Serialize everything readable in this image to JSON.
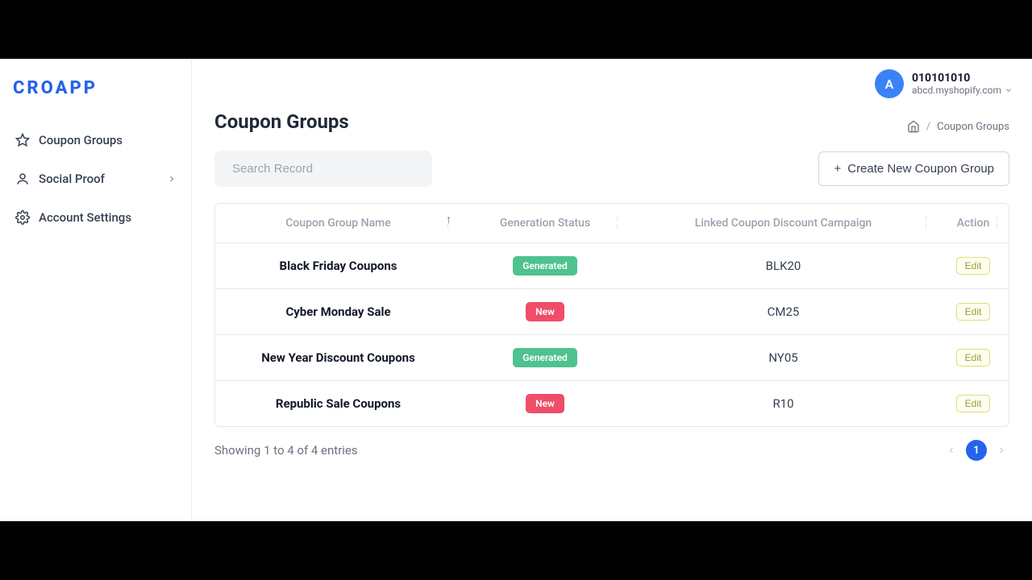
{
  "brand": "CROAPP",
  "user": {
    "avatar_letter": "A",
    "name": "010101010",
    "store": "abcd.myshopify.com"
  },
  "sidebar": {
    "items": [
      {
        "label": "Coupon Groups"
      },
      {
        "label": "Social Proof"
      },
      {
        "label": "Account Settings"
      }
    ]
  },
  "page": {
    "title": "Coupon Groups",
    "breadcrumb_current": "Coupon Groups",
    "breadcrumb_sep": "/"
  },
  "search": {
    "placeholder": "Search Record"
  },
  "buttons": {
    "create": "Create New Coupon Group",
    "edit": "Edit"
  },
  "table": {
    "headers": {
      "name": "Coupon Group Name",
      "status": "Generation Status",
      "campaign": "Linked Coupon Discount Campaign",
      "action": "Action"
    },
    "status_labels": {
      "generated": "Generated",
      "new": "New"
    },
    "rows": [
      {
        "name": "Black Friday Coupons",
        "status": "generated",
        "campaign": "BLK20"
      },
      {
        "name": "Cyber Monday Sale",
        "status": "new",
        "campaign": "CM25"
      },
      {
        "name": "New Year Discount Coupons",
        "status": "generated",
        "campaign": "NY05"
      },
      {
        "name": "Republic Sale Coupons",
        "status": "new",
        "campaign": "R10"
      }
    ]
  },
  "pagination": {
    "summary": "Showing 1 to 4 of 4 entries",
    "current": "1"
  }
}
